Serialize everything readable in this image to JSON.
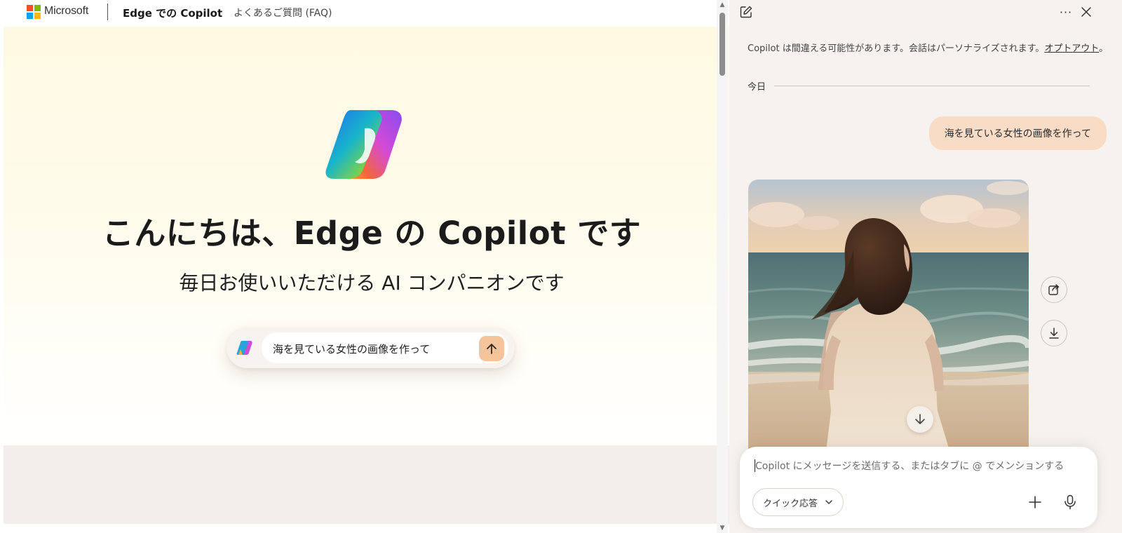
{
  "page": {
    "brand": "Microsoft",
    "nav_title": "Edge での Copilot",
    "nav_faq": "よくあるご質問 (FAQ)",
    "hero_title": "こんにちは、Edge の Copilot です",
    "hero_subtitle": "毎日お使いいただける AI コンパニオンです",
    "prompt_text": "海を見ている女性の画像を作って"
  },
  "panel": {
    "disclaimer_text": "Copilot は間違える可能性があります。会話はパーソナライズされます。",
    "disclaimer_link": "オプトアウト",
    "disclaimer_end": "。",
    "today_label": "今日",
    "user_message": "海を見ている女性の画像を作って",
    "composer_placeholder": "Copilot にメッセージを送信する、またはタブに @ でメンションする",
    "mode_label": "クイック応答"
  },
  "colors": {
    "accent": "#f6c49b",
    "user_bubble": "#f9dcc6",
    "panel_bg": "#f6f2ef",
    "ms_red": "#f25022",
    "ms_green": "#7fba00",
    "ms_blue": "#00a4ef",
    "ms_yellow": "#ffb900"
  },
  "icons": {
    "new_chat": "new-chat-icon",
    "more": "more-icon",
    "close": "close-icon",
    "share": "share-icon",
    "download": "download-icon",
    "scroll_down": "arrow-down-icon",
    "send": "arrow-up-icon",
    "add": "plus-icon",
    "mic": "microphone-icon",
    "chevron": "chevron-down-icon"
  }
}
